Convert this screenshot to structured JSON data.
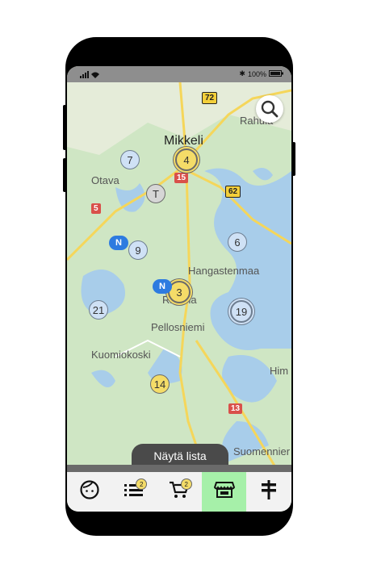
{
  "status_bar": {
    "battery": "100%"
  },
  "map": {
    "places": {
      "mikkeli": "Mikkeli",
      "rahula": "Rahula",
      "otava": "Otava",
      "hangastenmaa": "Hangastenmaa",
      "ristiina": "Ristiina",
      "pellosniemi": "Pellosniemi",
      "kuomiokoski": "Kuomiokoski",
      "him": "Him",
      "suomenniemi": "Suomennier"
    },
    "roads": {
      "r72": "72",
      "r15": "15",
      "r62": "62",
      "r5": "5",
      "r13": "13"
    },
    "clusters": {
      "c4": "4",
      "c7": "7",
      "ct": "T",
      "c9": "9",
      "c6": "6",
      "c3": "3",
      "c21": "21",
      "c19": "19",
      "c14": "14"
    },
    "pins": {
      "n1": "N",
      "n2": "N"
    }
  },
  "list_button": "Näytä lista",
  "nav": {
    "badge_list": "2",
    "badge_cart": "2"
  },
  "colors": {
    "active_tab": "#a6f0a9",
    "marker_yellow": "#f4dc68",
    "marker_blue": "#cfe1f5",
    "pin_blue": "#2d7be0"
  }
}
